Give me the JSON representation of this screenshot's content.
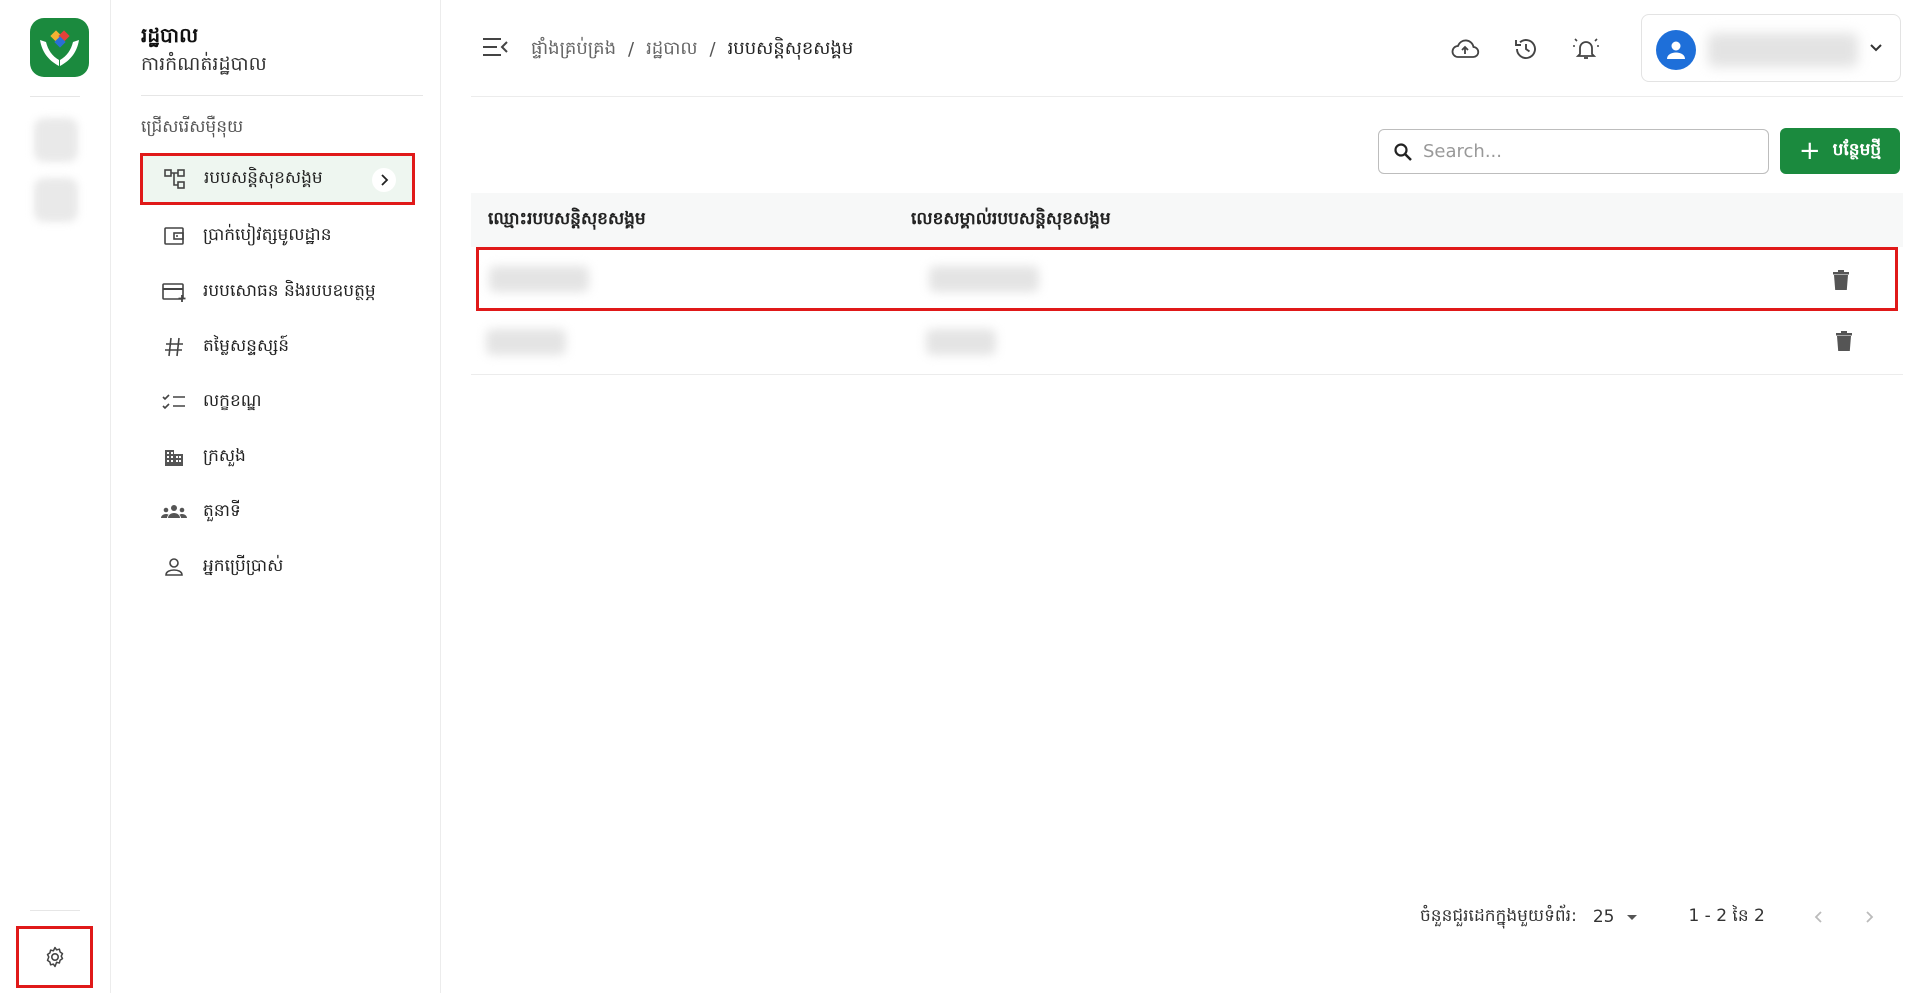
{
  "sidenav": {
    "title": "រដ្ឋបាល",
    "subtitle": "ការកំណត់រដ្ឋបាល",
    "section_label": "ជ្រើសរើសម៉ឺនុយ",
    "items": [
      {
        "label": "របបសន្តិសុខសង្គម",
        "icon": "hierarchy-icon"
      },
      {
        "label": "ប្រាក់បៀវត្សមូលដ្ឋាន",
        "icon": "wallet-icon"
      },
      {
        "label": "របបសោធន និងរបបឧបត្ថម្ភ",
        "icon": "card-plus-icon"
      },
      {
        "label": "តម្លៃសន្ទស្សន៍",
        "icon": "hash-icon"
      },
      {
        "label": "លក្ខខណ្ឌ",
        "icon": "checklist-icon"
      },
      {
        "label": "ក្រសួង",
        "icon": "building-icon"
      },
      {
        "label": "តួនាទី",
        "icon": "group-icon"
      },
      {
        "label": "អ្នកប្រើប្រាស់",
        "icon": "person-icon"
      }
    ]
  },
  "header": {
    "breadcrumb": [
      "ផ្ទាំងគ្រប់គ្រង",
      "រដ្ឋបាល",
      "របបសន្តិសុខសង្គម"
    ]
  },
  "toolbar": {
    "search_placeholder": "Search...",
    "add_label": "បន្ថែមថ្មី"
  },
  "table": {
    "columns": [
      "ឈ្មោះរបបសន្តិសុខសង្គម",
      "លេខសម្គាល់របបសន្តិសុខសង្គម"
    ]
  },
  "footer": {
    "rows_per_page_label": "ចំនួនជួរដេកក្នុងមួយទំព័រ:",
    "rows_per_page": "25",
    "range": "1 - 2 នៃ 2"
  },
  "colors": {
    "primary": "#1b8a3e",
    "highlight": "#e01919",
    "avatar": "#1e6fd9"
  }
}
